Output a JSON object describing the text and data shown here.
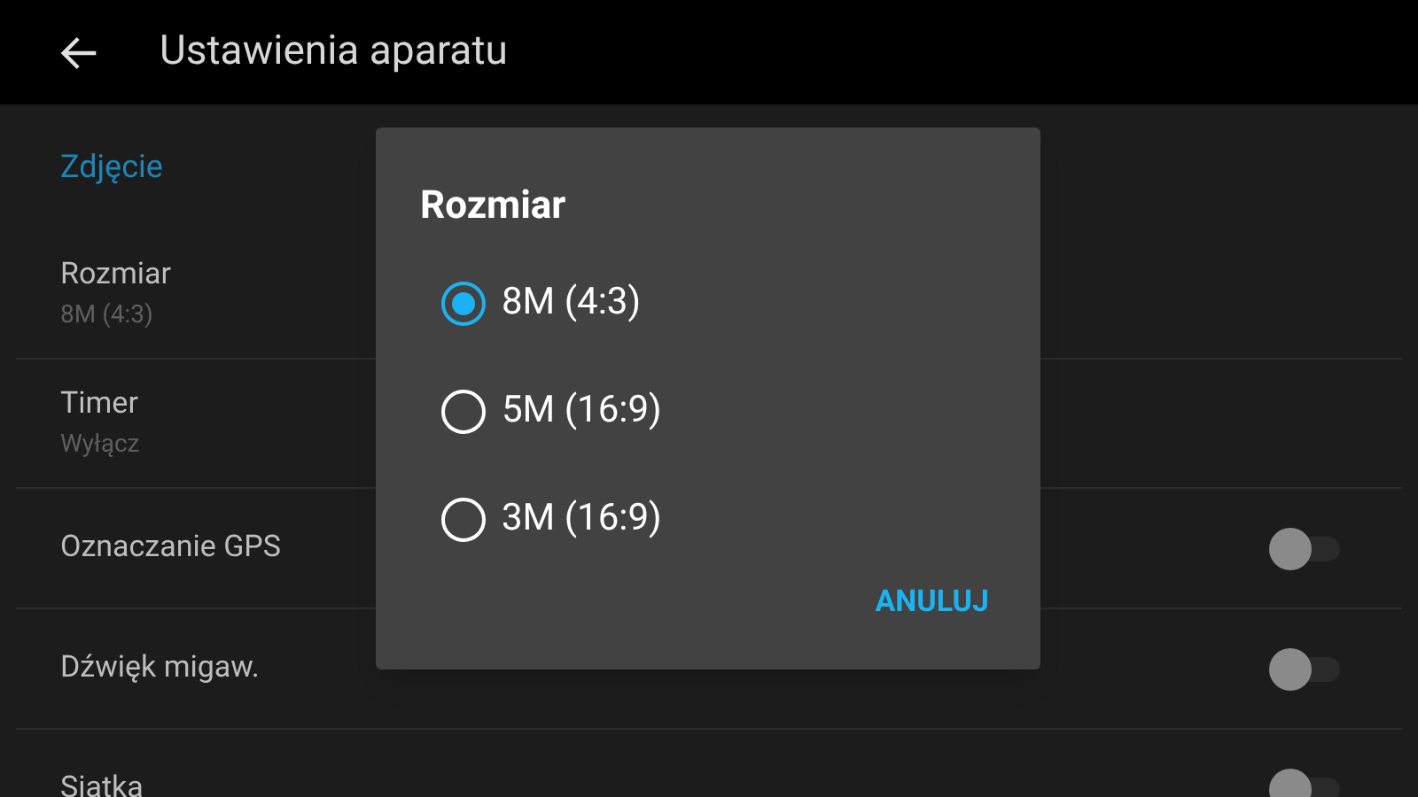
{
  "header": {
    "title": "Ustawienia aparatu"
  },
  "section": {
    "title": "Zdjęcie"
  },
  "settings": [
    {
      "kind": "detail",
      "label": "Rozmiar",
      "value": "8M (4:3)"
    },
    {
      "kind": "detail",
      "label": "Timer",
      "value": "Wyłącz"
    },
    {
      "kind": "switch",
      "label": "Oznaczanie GPS",
      "on": false
    },
    {
      "kind": "switch",
      "label": "Dźwięk migaw.",
      "on": false
    },
    {
      "kind": "switch",
      "label": "Siatka",
      "on": false
    }
  ],
  "dialog": {
    "title": "Rozmiar",
    "options": [
      {
        "label": "8M (4:3)",
        "selected": true
      },
      {
        "label": "5M (16:9)",
        "selected": false
      },
      {
        "label": "3M (16:9)",
        "selected": false
      }
    ],
    "button": "ANULUJ"
  }
}
